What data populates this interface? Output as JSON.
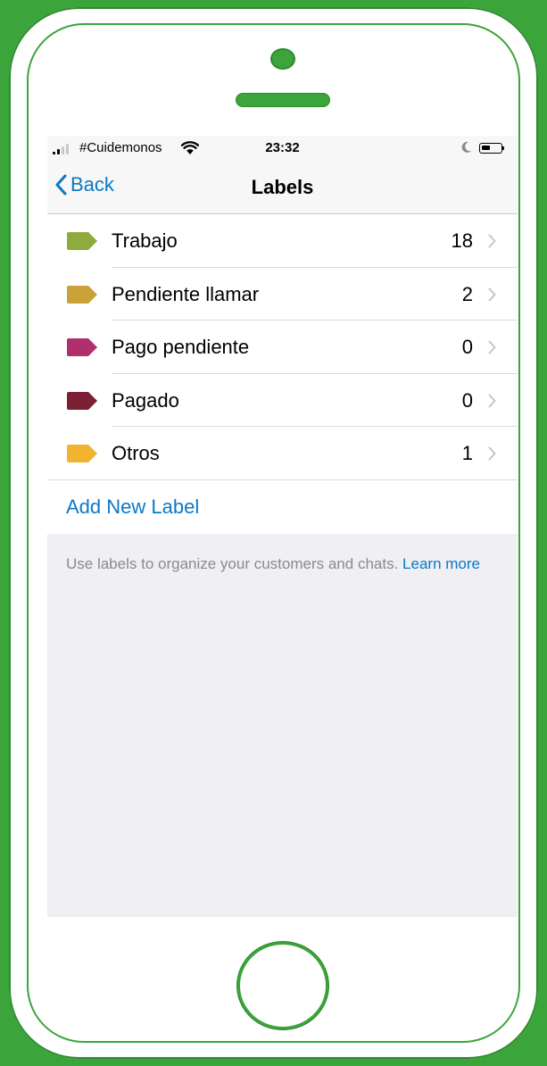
{
  "status_bar": {
    "carrier": "#Cuidemonos",
    "time": "23:32",
    "icons": [
      "signal-icon",
      "wifi-icon",
      "moon-icon",
      "battery-icon"
    ]
  },
  "nav": {
    "back_label": "Back",
    "title": "Labels"
  },
  "labels": [
    {
      "name": "Trabajo",
      "count": "18",
      "color": "#8eab3d"
    },
    {
      "name": "Pendiente llamar",
      "count": "2",
      "color": "#c9a33a"
    },
    {
      "name": "Pago pendiente",
      "count": "0",
      "color": "#b22f6e"
    },
    {
      "name": "Pagado",
      "count": "0",
      "color": "#7c2034"
    },
    {
      "name": "Otros",
      "count": "1",
      "color": "#f0b431"
    }
  ],
  "add_label": "Add New Label",
  "footer": {
    "text": "Use labels to organize your customers and chats.",
    "link": "Learn more"
  },
  "colors": {
    "accent": "#0a79c6",
    "frame": "#3ba43a"
  }
}
